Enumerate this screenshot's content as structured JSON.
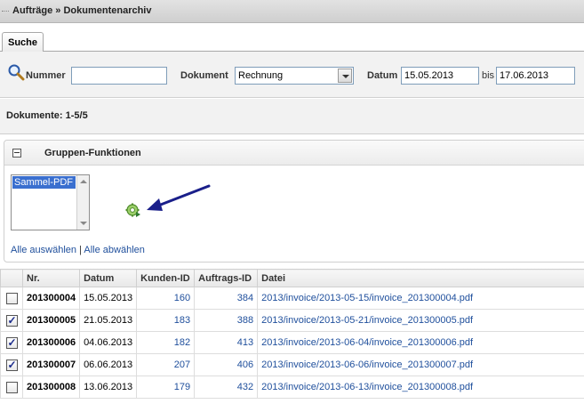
{
  "header": {
    "title": "Aufträge » Dokumentenarchiv"
  },
  "tabs": [
    {
      "label": "Suche"
    }
  ],
  "search": {
    "nummer_label": "Nummer",
    "nummer_value": "",
    "dokument_label": "Dokument",
    "dokument_value": "Rechnung",
    "datum_label": "Datum",
    "datum_from": "15.05.2013",
    "bis_label": "bis",
    "datum_to": "17.06.2013"
  },
  "documents_count": "Dokumente: 1-5/5",
  "group": {
    "title": "Gruppen-Funktionen",
    "options": [
      "Sammel-PDF"
    ],
    "select_all": "Alle auswählen",
    "separator": "|",
    "deselect_all": "Alle abwählen"
  },
  "table": {
    "columns": [
      "Nr.",
      "Datum",
      "Kunden-ID",
      "Auftrags-ID",
      "Datei"
    ],
    "rows": [
      {
        "checked": false,
        "nr": "201300004",
        "datum": "15.05.2013",
        "kunden_id": "160",
        "auftrags_id": "384",
        "datei": "2013/invoice/2013-05-15/invoice_201300004.pdf"
      },
      {
        "checked": true,
        "nr": "201300005",
        "datum": "21.05.2013",
        "kunden_id": "183",
        "auftrags_id": "388",
        "datei": "2013/invoice/2013-05-21/invoice_201300005.pdf"
      },
      {
        "checked": true,
        "nr": "201300006",
        "datum": "04.06.2013",
        "kunden_id": "182",
        "auftrags_id": "413",
        "datei": "2013/invoice/2013-06-04/invoice_201300006.pdf"
      },
      {
        "checked": true,
        "nr": "201300007",
        "datum": "06.06.2013",
        "kunden_id": "207",
        "auftrags_id": "406",
        "datei": "2013/invoice/2013-06-06/invoice_201300007.pdf"
      },
      {
        "checked": false,
        "nr": "201300008",
        "datum": "13.06.2013",
        "kunden_id": "179",
        "auftrags_id": "432",
        "datei": "2013/invoice/2013-06-13/invoice_201300008.pdf"
      }
    ]
  },
  "icons": {
    "search": "magnifier-icon",
    "group_toggle": "collapse-icon",
    "execute": "gear-icon",
    "annotation": "arrow-annotation"
  },
  "colors": {
    "link": "#1f4f9c",
    "selection": "#3a6fcf",
    "annotation": "#1a1f8a"
  }
}
